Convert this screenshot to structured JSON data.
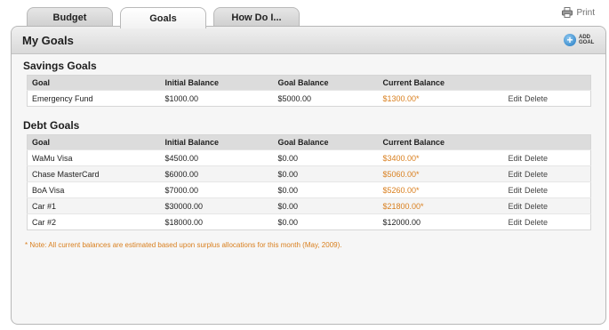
{
  "tabs": [
    {
      "label": "Budget",
      "active": false
    },
    {
      "label": "Goals",
      "active": true
    },
    {
      "label": "How Do I...",
      "active": false
    }
  ],
  "print_label": "Print",
  "panel": {
    "title": "My Goals",
    "add_goal_label": "ADD GOAL",
    "add_icon": "plus-circle-icon"
  },
  "columns": [
    "Goal",
    "Initial Balance",
    "Goal Balance",
    "Current Balance"
  ],
  "savings": {
    "title": "Savings Goals",
    "rows": [
      {
        "goal": "Emergency Fund",
        "initial": "$1000.00",
        "goal_balance": "$5000.00",
        "current": "$1300.00*",
        "estimated": true
      }
    ]
  },
  "debt": {
    "title": "Debt Goals",
    "rows": [
      {
        "goal": "WaMu Visa",
        "initial": "$4500.00",
        "goal_balance": "$0.00",
        "current": "$3400.00*",
        "estimated": true
      },
      {
        "goal": "Chase MasterCard",
        "initial": "$6000.00",
        "goal_balance": "$0.00",
        "current": "$5060.00*",
        "estimated": true
      },
      {
        "goal": "BoA Visa",
        "initial": "$7000.00",
        "goal_balance": "$0.00",
        "current": "$5260.00*",
        "estimated": true
      },
      {
        "goal": "Car #1",
        "initial": "$30000.00",
        "goal_balance": "$0.00",
        "current": "$21800.00*",
        "estimated": true
      },
      {
        "goal": "Car #2",
        "initial": "$18000.00",
        "goal_balance": "$0.00",
        "current": "$12000.00",
        "estimated": false
      }
    ]
  },
  "row_actions": {
    "edit": "Edit",
    "delete": "Delete"
  },
  "note": "* Note: All current balances are estimated based upon surplus allocations for this month (May, 2009).",
  "colors": {
    "accent_orange": "#d97f1e",
    "add_icon_blue": "#1f78c1"
  }
}
